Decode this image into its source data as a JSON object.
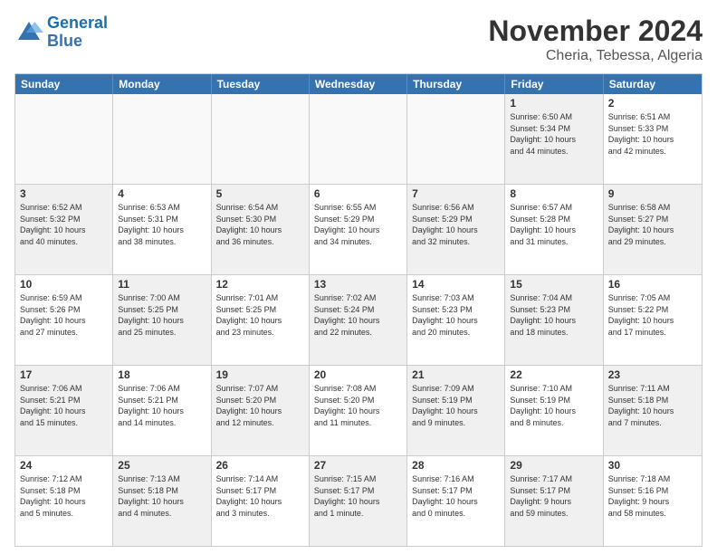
{
  "logo": {
    "line1": "General",
    "line2": "Blue"
  },
  "title": "November 2024",
  "subtitle": "Cheria, Tebessa, Algeria",
  "weekdays": [
    "Sunday",
    "Monday",
    "Tuesday",
    "Wednesday",
    "Thursday",
    "Friday",
    "Saturday"
  ],
  "rows": [
    [
      {
        "day": "",
        "info": "",
        "empty": true
      },
      {
        "day": "",
        "info": "",
        "empty": true
      },
      {
        "day": "",
        "info": "",
        "empty": true
      },
      {
        "day": "",
        "info": "",
        "empty": true
      },
      {
        "day": "",
        "info": "",
        "empty": true
      },
      {
        "day": "1",
        "info": "Sunrise: 6:50 AM\nSunset: 5:34 PM\nDaylight: 10 hours\nand 44 minutes.",
        "shaded": true
      },
      {
        "day": "2",
        "info": "Sunrise: 6:51 AM\nSunset: 5:33 PM\nDaylight: 10 hours\nand 42 minutes.",
        "shaded": false
      }
    ],
    [
      {
        "day": "3",
        "info": "Sunrise: 6:52 AM\nSunset: 5:32 PM\nDaylight: 10 hours\nand 40 minutes.",
        "shaded": true
      },
      {
        "day": "4",
        "info": "Sunrise: 6:53 AM\nSunset: 5:31 PM\nDaylight: 10 hours\nand 38 minutes.",
        "shaded": false
      },
      {
        "day": "5",
        "info": "Sunrise: 6:54 AM\nSunset: 5:30 PM\nDaylight: 10 hours\nand 36 minutes.",
        "shaded": true
      },
      {
        "day": "6",
        "info": "Sunrise: 6:55 AM\nSunset: 5:29 PM\nDaylight: 10 hours\nand 34 minutes.",
        "shaded": false
      },
      {
        "day": "7",
        "info": "Sunrise: 6:56 AM\nSunset: 5:29 PM\nDaylight: 10 hours\nand 32 minutes.",
        "shaded": true
      },
      {
        "day": "8",
        "info": "Sunrise: 6:57 AM\nSunset: 5:28 PM\nDaylight: 10 hours\nand 31 minutes.",
        "shaded": false
      },
      {
        "day": "9",
        "info": "Sunrise: 6:58 AM\nSunset: 5:27 PM\nDaylight: 10 hours\nand 29 minutes.",
        "shaded": true
      }
    ],
    [
      {
        "day": "10",
        "info": "Sunrise: 6:59 AM\nSunset: 5:26 PM\nDaylight: 10 hours\nand 27 minutes.",
        "shaded": false
      },
      {
        "day": "11",
        "info": "Sunrise: 7:00 AM\nSunset: 5:25 PM\nDaylight: 10 hours\nand 25 minutes.",
        "shaded": true
      },
      {
        "day": "12",
        "info": "Sunrise: 7:01 AM\nSunset: 5:25 PM\nDaylight: 10 hours\nand 23 minutes.",
        "shaded": false
      },
      {
        "day": "13",
        "info": "Sunrise: 7:02 AM\nSunset: 5:24 PM\nDaylight: 10 hours\nand 22 minutes.",
        "shaded": true
      },
      {
        "day": "14",
        "info": "Sunrise: 7:03 AM\nSunset: 5:23 PM\nDaylight: 10 hours\nand 20 minutes.",
        "shaded": false
      },
      {
        "day": "15",
        "info": "Sunrise: 7:04 AM\nSunset: 5:23 PM\nDaylight: 10 hours\nand 18 minutes.",
        "shaded": true
      },
      {
        "day": "16",
        "info": "Sunrise: 7:05 AM\nSunset: 5:22 PM\nDaylight: 10 hours\nand 17 minutes.",
        "shaded": false
      }
    ],
    [
      {
        "day": "17",
        "info": "Sunrise: 7:06 AM\nSunset: 5:21 PM\nDaylight: 10 hours\nand 15 minutes.",
        "shaded": true
      },
      {
        "day": "18",
        "info": "Sunrise: 7:06 AM\nSunset: 5:21 PM\nDaylight: 10 hours\nand 14 minutes.",
        "shaded": false
      },
      {
        "day": "19",
        "info": "Sunrise: 7:07 AM\nSunset: 5:20 PM\nDaylight: 10 hours\nand 12 minutes.",
        "shaded": true
      },
      {
        "day": "20",
        "info": "Sunrise: 7:08 AM\nSunset: 5:20 PM\nDaylight: 10 hours\nand 11 minutes.",
        "shaded": false
      },
      {
        "day": "21",
        "info": "Sunrise: 7:09 AM\nSunset: 5:19 PM\nDaylight: 10 hours\nand 9 minutes.",
        "shaded": true
      },
      {
        "day": "22",
        "info": "Sunrise: 7:10 AM\nSunset: 5:19 PM\nDaylight: 10 hours\nand 8 minutes.",
        "shaded": false
      },
      {
        "day": "23",
        "info": "Sunrise: 7:11 AM\nSunset: 5:18 PM\nDaylight: 10 hours\nand 7 minutes.",
        "shaded": true
      }
    ],
    [
      {
        "day": "24",
        "info": "Sunrise: 7:12 AM\nSunset: 5:18 PM\nDaylight: 10 hours\nand 5 minutes.",
        "shaded": false
      },
      {
        "day": "25",
        "info": "Sunrise: 7:13 AM\nSunset: 5:18 PM\nDaylight: 10 hours\nand 4 minutes.",
        "shaded": true
      },
      {
        "day": "26",
        "info": "Sunrise: 7:14 AM\nSunset: 5:17 PM\nDaylight: 10 hours\nand 3 minutes.",
        "shaded": false
      },
      {
        "day": "27",
        "info": "Sunrise: 7:15 AM\nSunset: 5:17 PM\nDaylight: 10 hours\nand 1 minute.",
        "shaded": true
      },
      {
        "day": "28",
        "info": "Sunrise: 7:16 AM\nSunset: 5:17 PM\nDaylight: 10 hours\nand 0 minutes.",
        "shaded": false
      },
      {
        "day": "29",
        "info": "Sunrise: 7:17 AM\nSunset: 5:17 PM\nDaylight: 9 hours\nand 59 minutes.",
        "shaded": true
      },
      {
        "day": "30",
        "info": "Sunrise: 7:18 AM\nSunset: 5:16 PM\nDaylight: 9 hours\nand 58 minutes.",
        "shaded": false
      }
    ]
  ]
}
